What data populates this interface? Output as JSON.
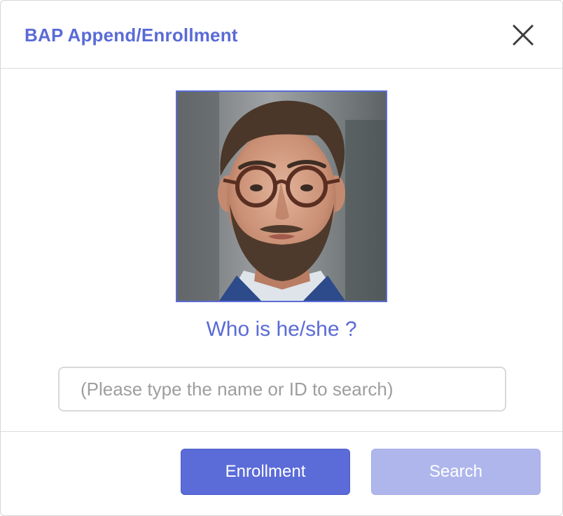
{
  "dialog": {
    "title": "BAP Append/Enrollment",
    "close_icon": "close-icon"
  },
  "photo": {
    "icon": "person-photo"
  },
  "prompt": {
    "question": "Who is he/she ?"
  },
  "search": {
    "value": "",
    "placeholder": "(Please type the name or ID to search)"
  },
  "actions": {
    "enroll_label": "Enrollment",
    "search_label": "Search"
  },
  "colors": {
    "accent": "#5a6bd6",
    "primary_button": "#5b6bd8",
    "disabled_button": "#aeb6ec",
    "border": "#dcdcdc"
  }
}
